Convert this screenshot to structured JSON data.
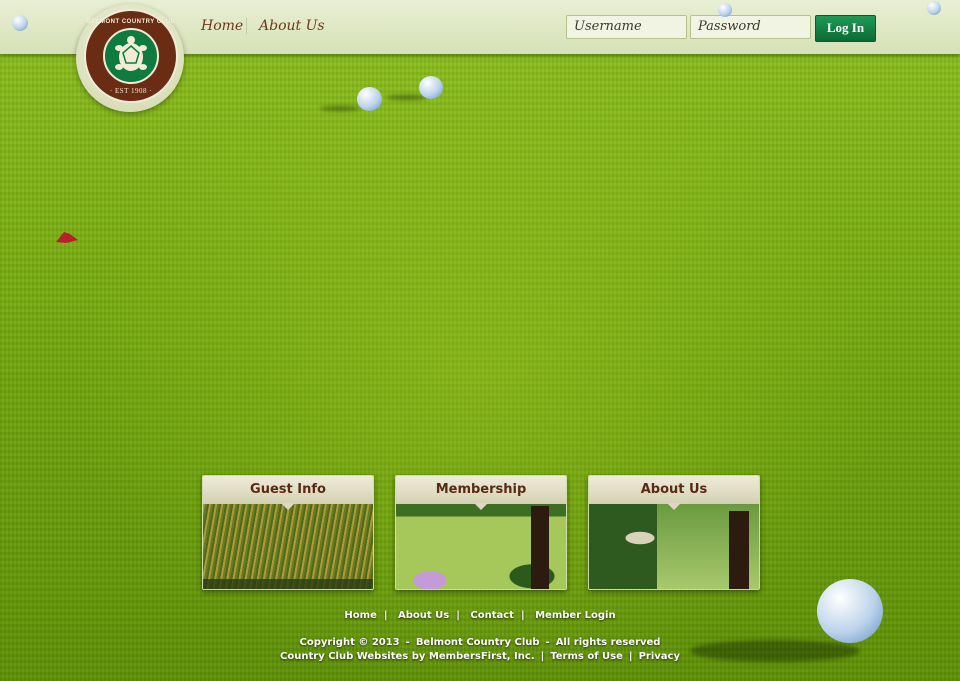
{
  "header": {
    "logo": {
      "top_text": "BELMONT COUNTRY CLUB",
      "bottom_text": "· EST 1908 ·",
      "colors": {
        "ring": "#6b2c14",
        "center": "#0f7b3e"
      }
    },
    "nav": [
      {
        "label": "Home"
      },
      {
        "label": "About Us"
      }
    ],
    "login": {
      "username_placeholder": "Username",
      "password_placeholder": "Password",
      "button_label": "Log In"
    }
  },
  "cards": [
    {
      "label": "Guest Info"
    },
    {
      "label": "Membership"
    },
    {
      "label": "About Us"
    }
  ],
  "footer": {
    "links": [
      "Home",
      "About Us",
      "Contact",
      "Member Login"
    ],
    "copyright": "Copyright © 2013",
    "club": "Belmont Country Club",
    "rights": "All rights reserved",
    "credit": "Country Club Websites by MembersFirst, Inc.",
    "terms": "Terms of Use",
    "privacy": "Privacy"
  },
  "colors": {
    "accent_green": "#0f7b3e",
    "brand_brown": "#6b2c14",
    "grass": "#7fb414"
  }
}
